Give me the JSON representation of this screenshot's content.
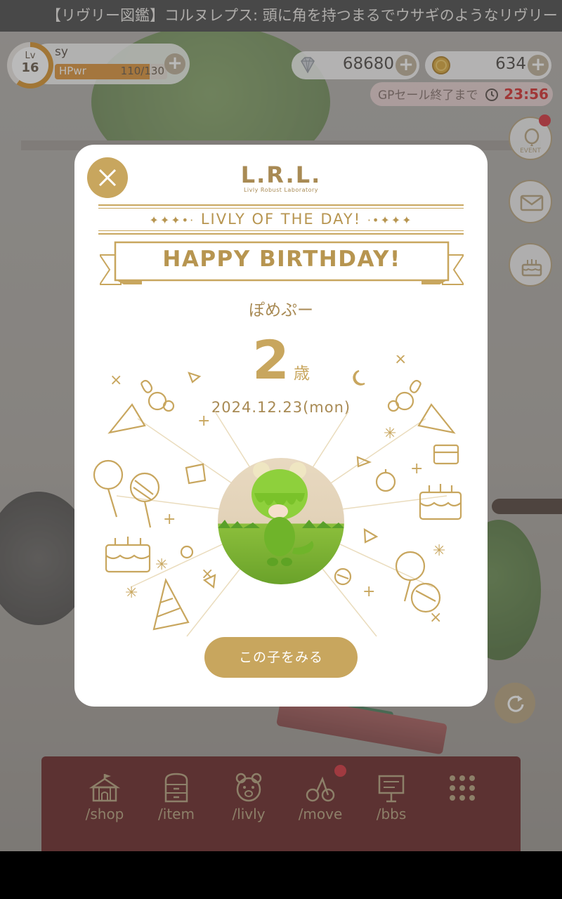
{
  "ticker": {
    "text": "【リヴリー図鑑】コルヌレプス: 頭に角を持つまるでウサギのようなリヴリー"
  },
  "player": {
    "level_label": "Lv",
    "level": "16",
    "name": "sy",
    "hp_label": "HPwr",
    "hp_value": "110/130",
    "hp_fraction": 0.846
  },
  "currencies": {
    "gems": "68680",
    "coins": "634"
  },
  "sale": {
    "label": "GPセール終了まで",
    "time": "23:56"
  },
  "side_buttons": {
    "event_label": "EVENT"
  },
  "modal": {
    "logo_title": "L.R.L.",
    "logo_subtitle": "Livly Robust Laboratory",
    "lotd_left": "✦✦✦•·",
    "lotd": "LIVLY OF THE DAY!",
    "lotd_right": "·•✦✦✦",
    "ribbon": "HAPPY BIRTHDAY!",
    "livly_name": "ぽめぷー",
    "age": "2",
    "age_unit": "歳",
    "date": "2024.12.23(mon)",
    "view_button": "この子をみる"
  },
  "nav": [
    {
      "label": "/shop",
      "icon": "circus-tent-icon"
    },
    {
      "label": "/item",
      "icon": "cabinet-icon"
    },
    {
      "label": "/livly",
      "icon": "bear-icon"
    },
    {
      "label": "/move",
      "icon": "move-icon"
    },
    {
      "label": "/bbs",
      "icon": "signboard-icon"
    },
    {
      "label": "",
      "icon": "grid-menu-icon"
    }
  ],
  "colors": {
    "gold": "#c8a65e",
    "nav_bg": "#5e1515",
    "alert": "#d3242e",
    "sale_time": "#d21e1e"
  }
}
